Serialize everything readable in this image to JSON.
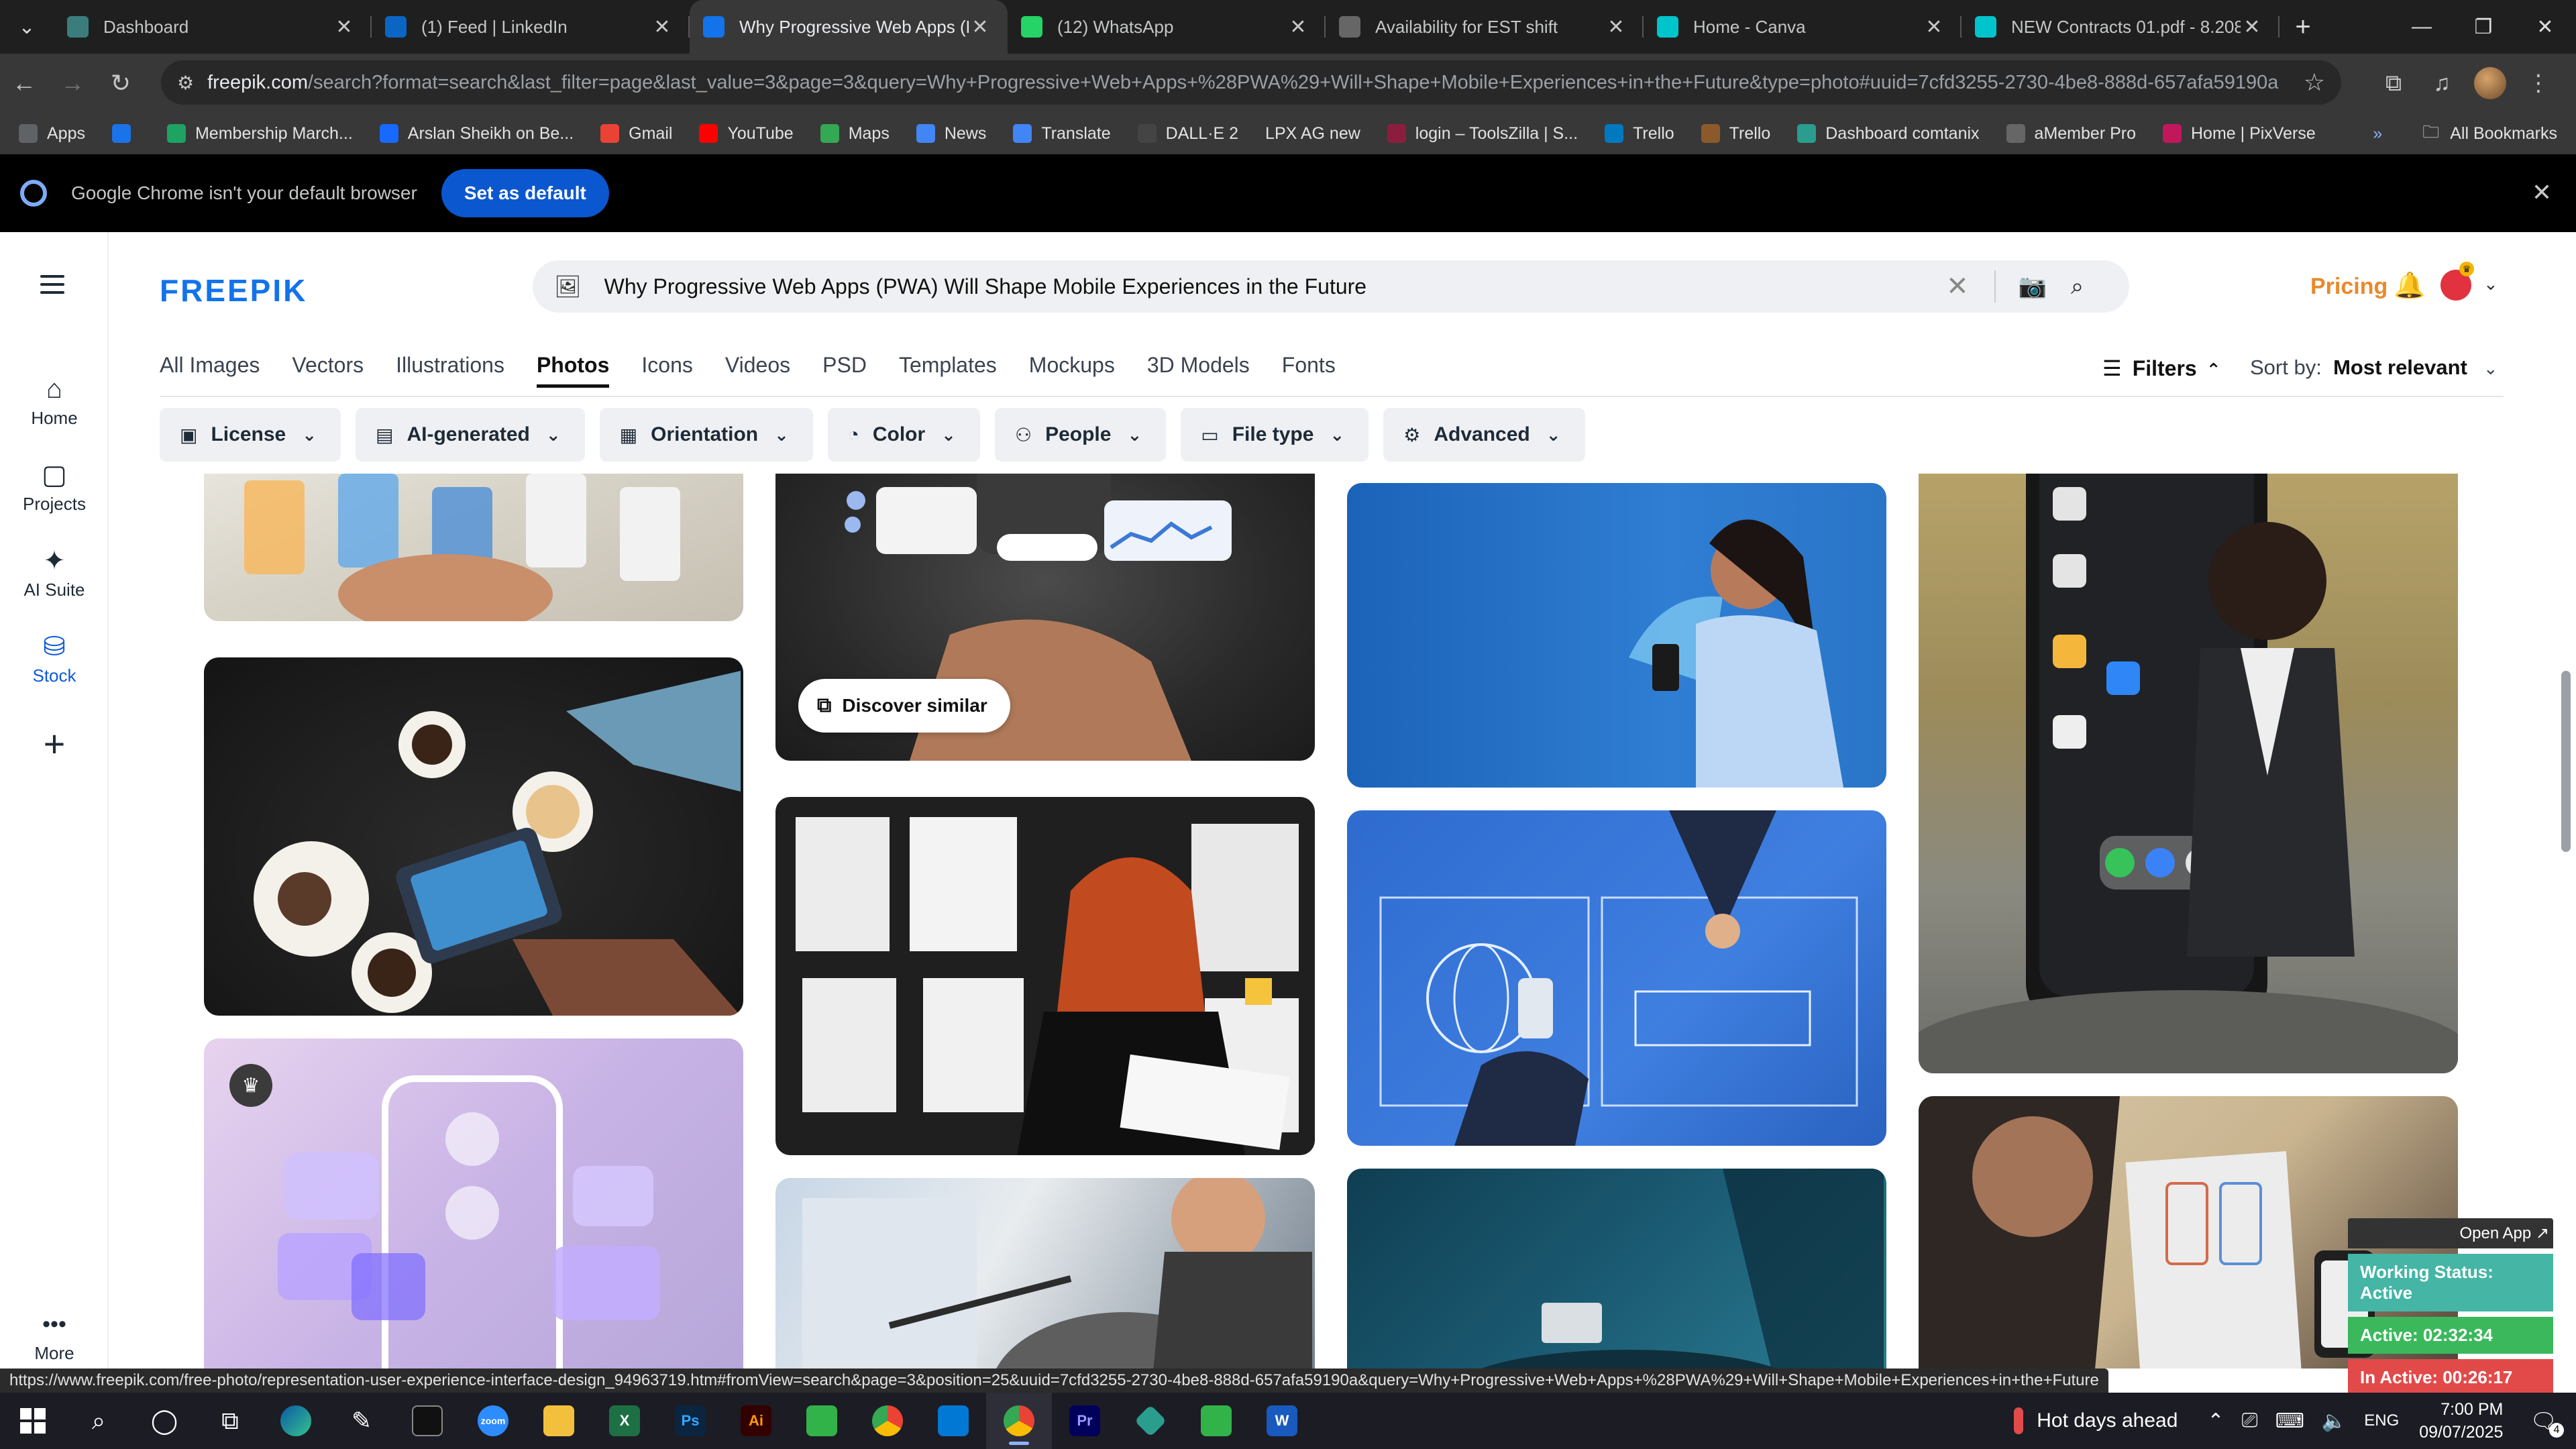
{
  "browser": {
    "tabs": [
      {
        "title": "Dashboard",
        "icon": "dashboard-icon",
        "color": "#3b7d7d",
        "active": false
      },
      {
        "title": "(1) Feed | LinkedIn",
        "icon": "linkedin-icon",
        "color": "#0a66c2",
        "active": false
      },
      {
        "title": "Why Progressive Web Apps (PW",
        "icon": "freepik-icon",
        "color": "#1273eb",
        "active": true
      },
      {
        "title": "(12) WhatsApp",
        "icon": "whatsapp-icon",
        "color": "#25d366",
        "active": false
      },
      {
        "title": "Availability for EST shift",
        "icon": "globe-icon",
        "color": "#666666",
        "active": false
      },
      {
        "title": "Home - Canva",
        "icon": "canva-icon",
        "color": "#00c4cc",
        "active": false
      },
      {
        "title": "NEW Contracts 01.pdf - 8.208",
        "icon": "canva-icon",
        "color": "#00c4cc",
        "active": false
      }
    ],
    "url_host": "freepik.com",
    "url_rest": "/search?format=search&last_filter=page&last_value=3&page=3&query=Why+Progressive+Web+Apps+%28PWA%29+Will+Shape+Mobile+Experiences+in+the+Future&type=photo#uuid=7cfd3255-2730-4be8-888d-657afa59190a",
    "bookmarks": [
      {
        "label": "Apps",
        "icon": "apps-grid-icon",
        "color": "#5f6368"
      },
      {
        "label": "",
        "icon": "grid-icon",
        "color": "#1a73e8"
      },
      {
        "label": "Membership March...",
        "icon": "plus-icon",
        "color": "#1ea362"
      },
      {
        "label": "Arslan Sheikh on Be...",
        "icon": "behance-icon",
        "color": "#1769ff"
      },
      {
        "label": "Gmail",
        "icon": "gmail-icon",
        "color": "#ea4335"
      },
      {
        "label": "YouTube",
        "icon": "youtube-icon",
        "color": "#ff0000"
      },
      {
        "label": "Maps",
        "icon": "maps-icon",
        "color": "#34a853"
      },
      {
        "label": "News",
        "icon": "news-icon",
        "color": "#4285f4"
      },
      {
        "label": "Translate",
        "icon": "translate-icon",
        "color": "#4285f4"
      },
      {
        "label": "DALL·E 2",
        "icon": "openai-icon",
        "color": "#444444"
      },
      {
        "label": "LPX AG new",
        "icon": "none",
        "color": "#383838"
      },
      {
        "label": "login – ToolsZilla | S...",
        "icon": "toolszilla-icon",
        "color": "#8b1e3f"
      },
      {
        "label": "Trello",
        "icon": "trello-icon",
        "color": "#0079bf"
      },
      {
        "label": "Trello",
        "icon": "trello-icon",
        "color": "#8b5a2b"
      },
      {
        "label": "Dashboard comtanix",
        "icon": "comtanix-icon",
        "color": "#2a9d8f"
      },
      {
        "label": "aMember Pro",
        "icon": "globe-icon",
        "color": "#666666"
      },
      {
        "label": "Home | PixVerse",
        "icon": "pixverse-icon",
        "color": "#c2185b"
      }
    ],
    "all_bookmarks": "All Bookmarks",
    "infobar": {
      "message": "Google Chrome isn't your default browser",
      "button": "Set as default"
    },
    "status_url": "https://www.freepik.com/free-photo/representation-user-experience-interface-design_94963719.htm#fromView=search&page=3&position=25&uuid=7cfd3255-2730-4be8-888d-657afa59190a&query=Why+Progressive+Web+Apps+%28PWA%29+Will+Shape+Mobile+Experiences+in+the+Future"
  },
  "freepik": {
    "logo": "FREEPIK",
    "sidenav": [
      {
        "label": "Home",
        "icon": "home-icon"
      },
      {
        "label": "Projects",
        "icon": "projects-icon"
      },
      {
        "label": "AI Suite",
        "icon": "ai-sparkle-icon"
      },
      {
        "label": "Stock",
        "icon": "stock-icon"
      }
    ],
    "more": "More",
    "search_query": "Why Progressive Web Apps (PWA) Will Shape Mobile Experiences in the Future",
    "pricing": "Pricing",
    "type_tabs": [
      "All Images",
      "Vectors",
      "Illustrations",
      "Photos",
      "Icons",
      "Videos",
      "PSD",
      "Templates",
      "Mockups",
      "3D Models",
      "Fonts"
    ],
    "active_tab": "Photos",
    "filters_label": "Filters",
    "sort_label": "Sort by:",
    "sort_value": "Most relevant",
    "filter_chips": [
      {
        "label": "License",
        "icon": "license-icon"
      },
      {
        "label": "AI-generated",
        "icon": "ai-generated-icon"
      },
      {
        "label": "Orientation",
        "icon": "orientation-icon"
      },
      {
        "label": "Color",
        "icon": "palette-icon"
      },
      {
        "label": "People",
        "icon": "people-icon"
      },
      {
        "label": "File type",
        "icon": "file-icon"
      },
      {
        "label": "Advanced",
        "icon": "advanced-settings-icon"
      }
    ],
    "discover_similar": "Discover similar"
  },
  "work_widget": {
    "open_app": "Open App ↗",
    "status": "Working Status: Active",
    "active": "Active: 02:32:34",
    "inactive": "In Active: 00:26:17"
  },
  "taskbar": {
    "weather": "Hot days ahead",
    "lang": "ENG",
    "time": "7:00 PM",
    "date": "09/07/2025",
    "notifications": "4"
  }
}
